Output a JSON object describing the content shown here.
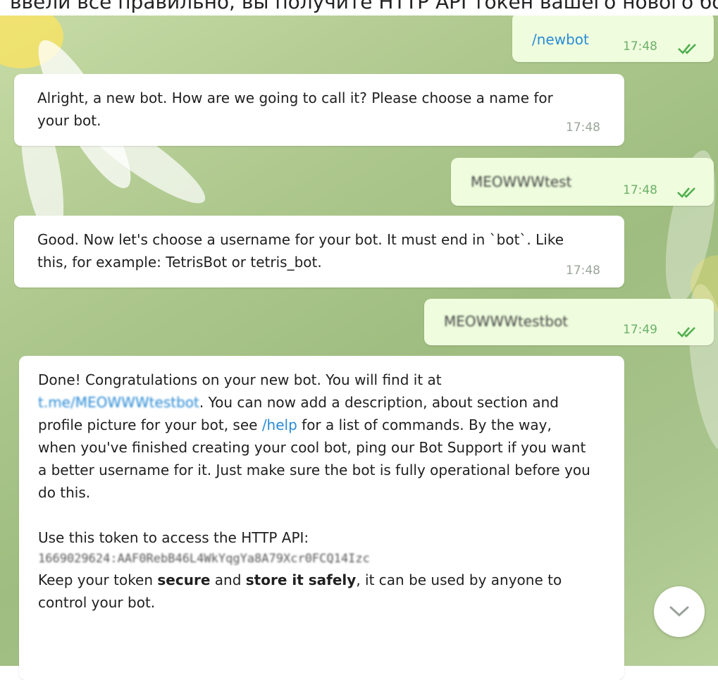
{
  "caption": "ввели все правильно, вы получите HTTP API токен вашего нового бота.",
  "messages": [
    {
      "dir": "out",
      "text": "/newbot",
      "time": "17:48"
    },
    {
      "dir": "in",
      "text": "Alright, a new bot. How are we going to call it? Please choose a name for your bot.",
      "time": "17:48"
    },
    {
      "dir": "out",
      "text": "MEOWWWtest",
      "time": "17:48"
    },
    {
      "dir": "in",
      "text": "Good. Now let's choose a username for your bot. It must end in `bot`. Like this, for example: TetrisBot or tetris_bot.",
      "time": "17:48"
    },
    {
      "dir": "out",
      "text": "MEOWWWtestbot",
      "time": "17:49"
    },
    {
      "dir": "in",
      "p1_a": "Done! Congratulations on your new bot. You will find it at",
      "link_botname": "t.me/MEOWWWtestbot",
      "p1_b": ". You can now add a description, about section and profile picture for your bot, see",
      "link_help": "/help",
      "p1_c": "for a list of commands. By the way, when you've finished creating your cool bot, ping our Bot Support if you want a better username for it. Just make sure the bot is fully operational before you do this.",
      "p2": "Use this token to access the HTTP API:",
      "token": "1669029624:AAF0RebB46L4WkYqgYa8A79Xcr0FCQ14Izc",
      "p3_a": "Keep your token",
      "p3_b": "secure",
      "p3_c": "and",
      "p3_d": "store it safely",
      "p3_e": ", it can be used by anyone to control your bot."
    }
  ],
  "icons": {
    "read": "double-check-icon",
    "scroll": "chevron-down-icon"
  },
  "colors": {
    "outgoing": "#effdde",
    "incoming": "#ffffff",
    "link": "#2a8bd6",
    "tick": "#4fae4e"
  }
}
